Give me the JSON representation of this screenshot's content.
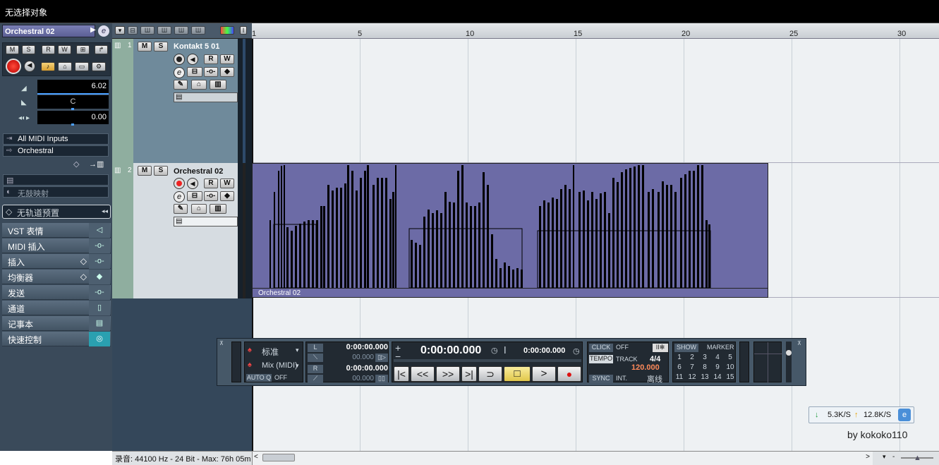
{
  "window": {
    "title": "无选择对象"
  },
  "inspector": {
    "track_name": "Orchestral 02",
    "volume": "6.02",
    "pan": "C",
    "delay": "0.00",
    "input": "All MIDI Inputs",
    "output": "Orchestral",
    "drum_map": "无鼓映射",
    "track_preset": "无轨道预置",
    "sections": [
      "VST 表情",
      "MIDI 插入",
      "插入",
      "均衡器",
      "发送",
      "通道",
      "记事本",
      "快速控制"
    ],
    "buttons": {
      "m": "M",
      "s": "S",
      "r": "R",
      "w": "W"
    }
  },
  "tracks": [
    {
      "number": "1",
      "name": "Kontakt 5 01"
    },
    {
      "number": "2",
      "name": "Orchestral 02"
    }
  ],
  "ruler": {
    "marks": [
      "1",
      "5",
      "10",
      "15",
      "20",
      "25",
      "30"
    ]
  },
  "part": {
    "name": "Orchestral 02",
    "color": "#6c6ba6"
  },
  "transport": {
    "mode": "标准",
    "mix": "Mix (MIDI)",
    "autoq_label": "AUTO Q",
    "autoq_value": "OFF",
    "left_locator": "0:00:00.000",
    "left_sub": "00.000",
    "right_locator": "0:00:00.000",
    "right_sub": "00.000",
    "main_time": "0:00:00.000",
    "secondary_time": "0:00:00.000",
    "click_label": "CLICK",
    "click_value": "OFF",
    "tempo_label": "TEMPO",
    "tempo_mode": "TRACK",
    "signature": "4/4",
    "tempo": "120.000",
    "sync_label": "SYNC",
    "sync_value": "INT.",
    "offline": "离线",
    "show": "SHOW",
    "marker": "MARKER",
    "markers": [
      "1",
      "2",
      "3",
      "4",
      "5",
      "6",
      "7",
      "8",
      "9",
      "10",
      "11",
      "12",
      "13",
      "14",
      "15"
    ]
  },
  "network": {
    "down": "5.3K/S",
    "up": "12.8K/S"
  },
  "watermark": "by kokoko110",
  "status": "录音: 44100 Hz - 24 Bit - Max: 76h 05m"
}
